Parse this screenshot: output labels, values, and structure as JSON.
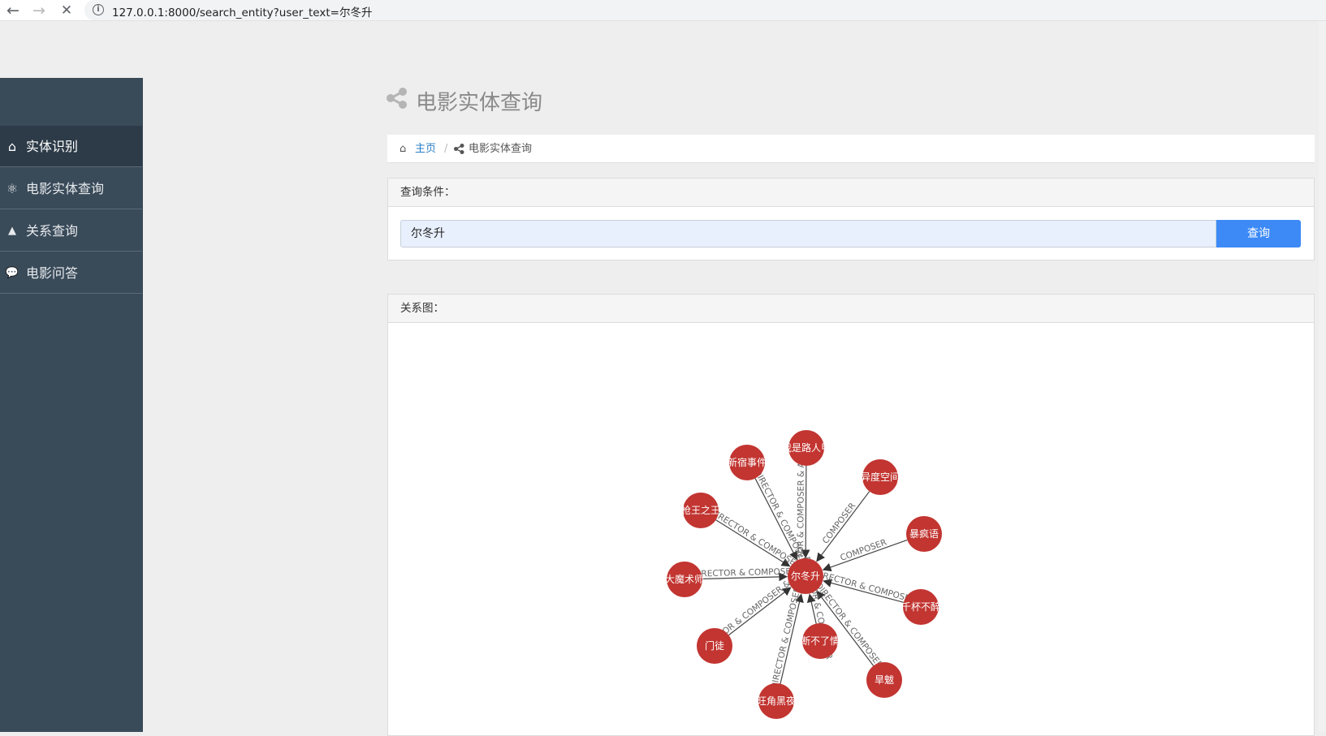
{
  "browser": {
    "back_icon": "←",
    "forward_icon": "→",
    "stop_icon": "✕",
    "info_icon": "i",
    "url": "127.0.0.1:8000/search_entity?user_text=尔冬升"
  },
  "sidebar": {
    "items": [
      {
        "label": "实体识别",
        "icon": "home-icon",
        "glyph": "⌂",
        "active": true
      },
      {
        "label": "电影实体查询",
        "icon": "atom-icon",
        "glyph": "⚛",
        "active": false
      },
      {
        "label": "关系查询",
        "icon": "drive-icon",
        "glyph": "▲",
        "active": false
      },
      {
        "label": "电影问答",
        "icon": "chat-icon",
        "glyph": "💬",
        "active": false
      }
    ]
  },
  "page": {
    "title": "电影实体查询",
    "title_icon": "share-icon"
  },
  "breadcrumb": {
    "home_icon": "⌂",
    "home": "主页",
    "separator": "/",
    "current": "电影实体查询"
  },
  "query": {
    "header": "查询条件：",
    "input_value": "尔冬升",
    "button_label": "查询"
  },
  "graph": {
    "header": "关系图：",
    "center": "尔冬升",
    "node_color": "#c23531",
    "nodes": [
      {
        "label": "新宿事件",
        "edge": "DIRECTOR & COMPOSER"
      },
      {
        "label": "我是路人甲",
        "edge": "DIRECTOR & COMPOSER & ACTOR"
      },
      {
        "label": "异度空间",
        "edge": "COMPOSER"
      },
      {
        "label": "暴疯语",
        "edge": "COMPOSER"
      },
      {
        "label": "千杯不醉",
        "edge": "DIRECTOR & COMPOSER"
      },
      {
        "label": "旱魃",
        "edge": "DIRECTOR & COMPOSER"
      },
      {
        "label": "断不了情",
        "edge": "DIRECTOR & COMPOSER"
      },
      {
        "label": "旺角黑夜",
        "edge": "DIRECTOR & COMPOSER"
      },
      {
        "label": "门徒",
        "edge": "DIRECTOR & COMPOSER & ACTOR"
      },
      {
        "label": "大魔术师",
        "edge": "DIRECTOR & COMPOSER"
      },
      {
        "label": "枪王之王",
        "edge": "DIRECTOR & COMPOSER"
      }
    ]
  }
}
